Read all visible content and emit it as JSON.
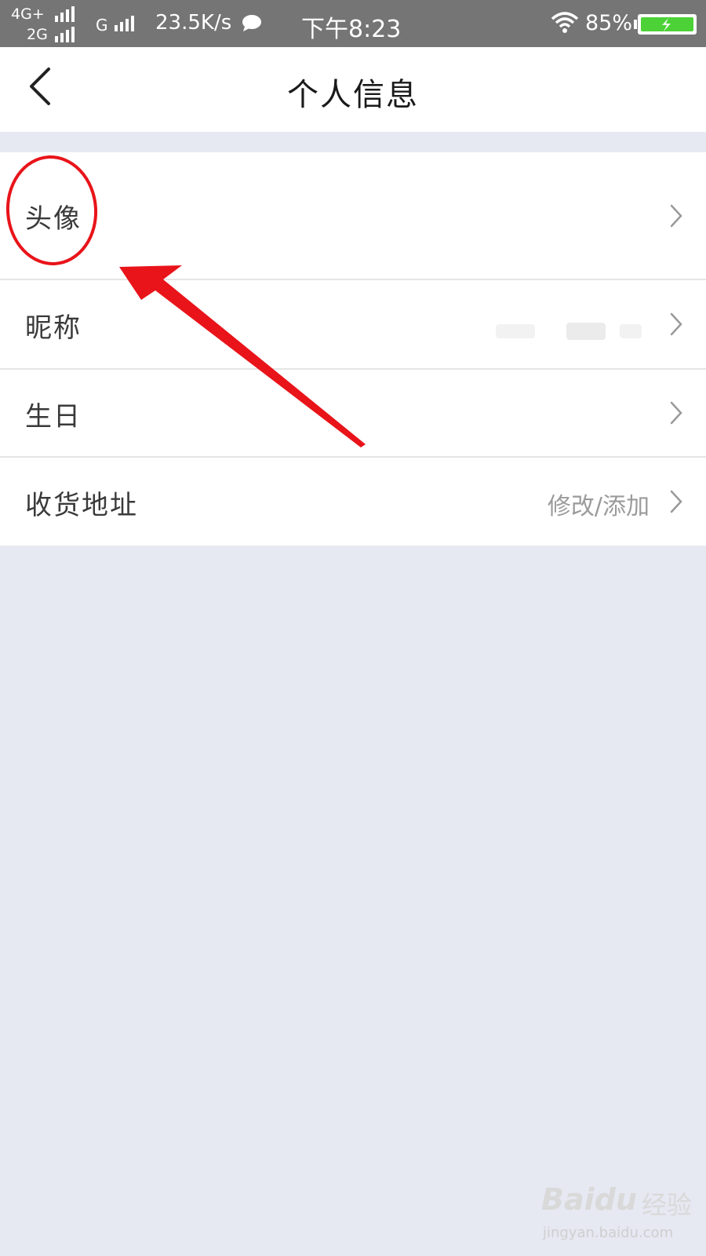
{
  "status_bar": {
    "net1": "4G+",
    "net2": "2G",
    "net3": "G",
    "speed": "23.5K/s",
    "time": "下午8:23",
    "battery": "85%",
    "icons": [
      "signal-bars-icon",
      "chat-bubble-icon",
      "wifi-icon",
      "battery-charging-icon"
    ]
  },
  "header": {
    "title": "个人信息",
    "back_icon": "chevron-left-icon"
  },
  "rows": [
    {
      "label": "头像",
      "value": ""
    },
    {
      "label": "昵称",
      "value": ""
    },
    {
      "label": "生日",
      "value": ""
    },
    {
      "label": "收货地址",
      "value": "修改/添加"
    }
  ],
  "annotation": {
    "highlight_color": "#e8141a",
    "shapes": [
      "ellipse",
      "arrow"
    ]
  },
  "watermark": {
    "brand": "Bai",
    "brand_tail": "du",
    "brand_cn": "经验",
    "url": "jingyan.baidu.com"
  },
  "colors": {
    "background": "#e6e8f2",
    "status_bar": "#757575",
    "battery_fill": "#4cd137"
  }
}
